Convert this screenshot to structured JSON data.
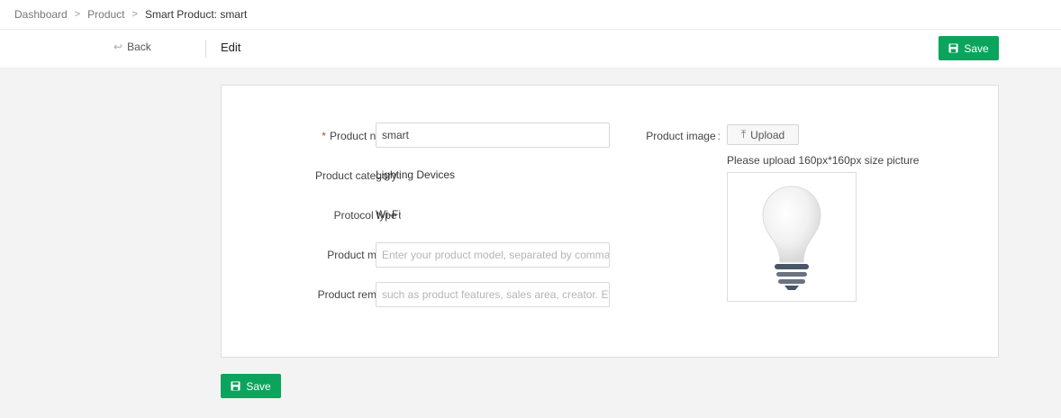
{
  "breadcrumb": {
    "items": [
      "Dashboard",
      "Product",
      "Smart Product: smart"
    ]
  },
  "header": {
    "back_label": "Back",
    "title": "Edit",
    "save_label": "Save"
  },
  "form": {
    "product_name": {
      "label": "Product name",
      "value": "smart"
    },
    "product_category": {
      "label": "Product category",
      "value": "Lighting Devices"
    },
    "protocol_type": {
      "label": "Protocol type",
      "value": "Wi-Fi"
    },
    "product_model": {
      "label": "Product model",
      "placeholder": "Enter your product model, separated by comma"
    },
    "product_remarks": {
      "label": "Product remarks",
      "placeholder": "such as product features, sales area, creator. Et"
    },
    "product_image": {
      "label": "Product image",
      "upload_label": "Upload",
      "hint": "Please upload 160px*160px size picture"
    }
  },
  "footer": {
    "save_label": "Save"
  },
  "colors": {
    "accent": "#0ba45d",
    "required": "#e23c1c"
  }
}
